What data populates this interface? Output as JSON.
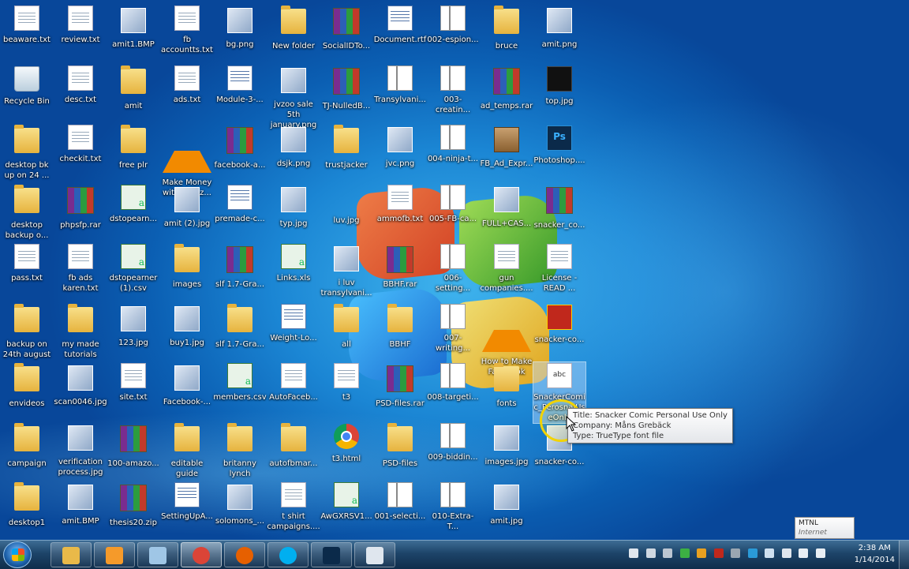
{
  "desktop": {
    "columns": [
      [
        {
          "label": "beaware.txt",
          "icon": "text-file-icon",
          "kind": "g-txt"
        },
        {
          "label": "Recycle Bin",
          "icon": "recycle-bin-icon",
          "kind": "g-recycle"
        },
        {
          "label": "desktop bk up on 24 ...",
          "icon": "folder-icon",
          "kind": "g-folder"
        },
        {
          "label": "desktop backup o...",
          "icon": "folder-icon",
          "kind": "g-folder"
        },
        {
          "label": "pass.txt",
          "icon": "text-file-icon",
          "kind": "g-txt"
        },
        {
          "label": "backup on 24th august",
          "icon": "folder-icon",
          "kind": "g-folder"
        },
        {
          "label": "envideos",
          "icon": "folder-icon",
          "kind": "g-folder"
        },
        {
          "label": "campaign",
          "icon": "folder-icon",
          "kind": "g-folder"
        },
        {
          "label": "desktop1",
          "icon": "folder-icon",
          "kind": "g-folder"
        }
      ],
      [
        {
          "label": "review.txt",
          "icon": "text-file-icon",
          "kind": "g-txt"
        },
        {
          "label": "desc.txt",
          "icon": "text-file-icon",
          "kind": "g-txt"
        },
        {
          "label": "checkit.txt",
          "icon": "text-file-icon",
          "kind": "g-txt"
        },
        {
          "label": "phpsfp.rar",
          "icon": "rar-archive-icon",
          "kind": "g-rar"
        },
        {
          "label": "fb ads karen.txt",
          "icon": "text-file-icon",
          "kind": "g-txt"
        },
        {
          "label": "my made tutorials",
          "icon": "folder-shortcut-icon",
          "kind": "g-folder"
        },
        {
          "label": "scan0046.jpg",
          "icon": "image-file-icon",
          "kind": "g-img"
        },
        {
          "label": "verification process.jpg",
          "icon": "image-file-icon",
          "kind": "g-img"
        },
        {
          "label": "amit.BMP",
          "icon": "image-file-icon",
          "kind": "g-img"
        }
      ],
      [
        {
          "label": "amit1.BMP",
          "icon": "image-file-icon",
          "kind": "g-img"
        },
        {
          "label": "amit",
          "icon": "folder-icon",
          "kind": "g-folder"
        },
        {
          "label": "free plr",
          "icon": "folder-icon",
          "kind": "g-folder"
        },
        {
          "label": "dstopearn...",
          "icon": "csv-file-icon",
          "kind": "g-xls"
        },
        {
          "label": "dstopearner (1).csv",
          "icon": "csv-file-icon",
          "kind": "g-xls"
        },
        {
          "label": "123.jpg",
          "icon": "image-file-icon",
          "kind": "g-img"
        },
        {
          "label": "site.txt",
          "icon": "text-file-icon",
          "kind": "g-txt"
        },
        {
          "label": "100-amazo...",
          "icon": "rar-archive-icon",
          "kind": "g-rar"
        },
        {
          "label": "thesis20.zip",
          "icon": "rar-archive-icon",
          "kind": "g-rar"
        }
      ],
      [
        {
          "label": "fb accountts.txt",
          "icon": "text-file-icon",
          "kind": "g-txt"
        },
        {
          "label": "ads.txt",
          "icon": "text-file-icon",
          "kind": "g-txt"
        },
        {
          "label": "Make Money with Amaz...",
          "icon": "vlc-media-icon",
          "kind": "g-vlc"
        },
        {
          "label": "amit (2).jpg",
          "icon": "image-file-icon",
          "kind": "g-img"
        },
        {
          "label": "images",
          "icon": "folder-icon",
          "kind": "g-folder"
        },
        {
          "label": "buy1.jpg",
          "icon": "image-file-icon",
          "kind": "g-img"
        },
        {
          "label": "Facebook-...",
          "icon": "image-file-icon",
          "kind": "g-img"
        },
        {
          "label": "editable guide",
          "icon": "folder-icon",
          "kind": "g-folder"
        },
        {
          "label": "SettingUpA...",
          "icon": "document-icon",
          "kind": "g-doc"
        }
      ],
      [
        {
          "label": "bg.png",
          "icon": "image-file-icon",
          "kind": "g-img"
        },
        {
          "label": "Module-3-...",
          "icon": "document-icon",
          "kind": "g-doc"
        },
        {
          "label": "facebook-a...",
          "icon": "rar-archive-icon",
          "kind": "g-rar"
        },
        {
          "label": "premade-c...",
          "icon": "document-icon",
          "kind": "g-doc"
        },
        {
          "label": "slf 1.7-Gra...",
          "icon": "rar-archive-icon",
          "kind": "g-rar"
        },
        {
          "label": "slf 1.7-Gra...",
          "icon": "folder-icon",
          "kind": "g-folder"
        },
        {
          "label": "members.csv",
          "icon": "csv-file-icon",
          "kind": "g-xls"
        },
        {
          "label": "britanny lynch",
          "icon": "folder-icon",
          "kind": "g-folder"
        },
        {
          "label": "solomons_...",
          "icon": "image-file-icon",
          "kind": "g-img"
        }
      ],
      [
        {
          "label": "New folder",
          "icon": "folder-icon",
          "kind": "g-folder"
        },
        {
          "label": "jvzoo sale 5th january.png",
          "icon": "image-file-icon",
          "kind": "g-img"
        },
        {
          "label": "dsjk.png",
          "icon": "image-file-icon",
          "kind": "g-img"
        },
        {
          "label": "typ.jpg",
          "icon": "image-file-icon",
          "kind": "g-img"
        },
        {
          "label": "Links.xls",
          "icon": "excel-file-icon",
          "kind": "g-xls"
        },
        {
          "label": "Weight-Lo...",
          "icon": "document-icon",
          "kind": "g-doc"
        },
        {
          "label": "AutoFaceb...",
          "icon": "text-file-icon",
          "kind": "g-txt"
        },
        {
          "label": "autofbmar...",
          "icon": "folder-icon",
          "kind": "g-folder"
        },
        {
          "label": "t shirt campaigns....",
          "icon": "text-file-icon",
          "kind": "g-txt"
        }
      ],
      [
        {
          "label": "SocialIDTo...",
          "icon": "rar-archive-icon",
          "kind": "g-rar"
        },
        {
          "label": "TJ-NulledB...",
          "icon": "rar-archive-icon",
          "kind": "g-rar"
        },
        {
          "label": "trustjacker",
          "icon": "folder-icon",
          "kind": "g-folder"
        },
        {
          "label": "luv.jpg",
          "icon": "heart-image-icon",
          "kind": "g-heart"
        },
        {
          "label": "i luv transylvani...",
          "icon": "image-file-icon",
          "kind": "g-img"
        },
        {
          "label": "all",
          "icon": "folder-icon",
          "kind": "g-folder"
        },
        {
          "label": "t3",
          "icon": "blank-file-icon",
          "kind": "g-txt"
        },
        {
          "label": "t3.html",
          "icon": "chrome-html-icon",
          "kind": "g-chrome"
        },
        {
          "label": "AwGXRSV1...",
          "icon": "excel-file-icon",
          "kind": "g-xls"
        }
      ],
      [
        {
          "label": "Document.rtf",
          "icon": "document-icon",
          "kind": "g-doc"
        },
        {
          "label": "Transylvani...",
          "icon": "zip-file-icon",
          "kind": "g-zip"
        },
        {
          "label": "jvc.png",
          "icon": "image-file-icon",
          "kind": "g-img"
        },
        {
          "label": "ammofb.txt",
          "icon": "text-file-icon",
          "kind": "g-txt"
        },
        {
          "label": "BBHF.rar",
          "icon": "rar-archive-icon",
          "kind": "g-rar"
        },
        {
          "label": "BBHF",
          "icon": "folder-icon",
          "kind": "g-folder"
        },
        {
          "label": "PSD-files.rar",
          "icon": "rar-archive-icon",
          "kind": "g-rar"
        },
        {
          "label": "PSD-files",
          "icon": "folder-icon",
          "kind": "g-folder"
        },
        {
          "label": "001-selecti...",
          "icon": "zip-file-icon",
          "kind": "g-zip"
        }
      ],
      [
        {
          "label": "002-espion...",
          "icon": "zip-file-icon",
          "kind": "g-zip"
        },
        {
          "label": "003-creatin...",
          "icon": "zip-file-icon",
          "kind": "g-zip"
        },
        {
          "label": "004-ninja-t...",
          "icon": "zip-file-icon",
          "kind": "g-zip"
        },
        {
          "label": "005-FB-ca...",
          "icon": "zip-file-icon",
          "kind": "g-zip"
        },
        {
          "label": "006-setting...",
          "icon": "zip-file-icon",
          "kind": "g-zip"
        },
        {
          "label": "007-writing...",
          "icon": "zip-file-icon",
          "kind": "g-zip"
        },
        {
          "label": "008-targeti...",
          "icon": "zip-file-icon",
          "kind": "g-zip"
        },
        {
          "label": "009-biddin...",
          "icon": "zip-file-icon",
          "kind": "g-zip"
        },
        {
          "label": "010-Extra-T...",
          "icon": "zip-file-icon",
          "kind": "g-zip"
        }
      ],
      [
        {
          "label": "bruce",
          "icon": "folder-icon",
          "kind": "g-folder"
        },
        {
          "label": "ad_temps.rar",
          "icon": "rar-archive-icon",
          "kind": "g-rar"
        },
        {
          "label": "FB_Ad_Expr...",
          "icon": "package-icon",
          "kind": "g-box"
        },
        {
          "label": "FULL+CAS...",
          "icon": "image-file-icon",
          "kind": "g-img"
        },
        {
          "label": "gun companies....",
          "icon": "text-file-icon",
          "kind": "g-txt"
        },
        {
          "label": "How to Make Facebook C...",
          "icon": "vlc-media-icon",
          "kind": "g-vlc"
        },
        {
          "label": "fonts",
          "icon": "folder-icon",
          "kind": "g-folder"
        },
        {
          "label": "images.jpg",
          "icon": "image-file-icon",
          "kind": "g-img"
        },
        {
          "label": "amit.jpg",
          "icon": "image-file-icon",
          "kind": "g-img"
        }
      ],
      [
        {
          "label": "amit.png",
          "icon": "image-file-icon",
          "kind": "g-img"
        },
        {
          "label": "top.jpg",
          "icon": "dark-image-icon",
          "kind": "g-dark"
        },
        {
          "label": "Photoshop....",
          "icon": "photoshop-icon",
          "kind": "g-ps",
          "glyph": "Ps"
        },
        {
          "label": "snacker_co...",
          "icon": "rar-archive-icon",
          "kind": "g-rar"
        },
        {
          "label": "License - READ ...",
          "icon": "text-file-icon",
          "kind": "g-txt"
        },
        {
          "label": "snacker-co...",
          "icon": "comic-image-icon",
          "kind": "g-comic"
        },
        {
          "label": "SnackerComic_PerosnalUseOnly",
          "icon": "font-file-icon",
          "kind": "g-font",
          "glyph": "abc",
          "selected": true
        },
        {
          "label": "snacker-co...",
          "icon": "image-file-icon",
          "kind": "g-img"
        }
      ]
    ]
  },
  "tooltip": {
    "title": "Title: Snacker Comic Personal Use Only",
    "company": "Company: Måns Grebäck",
    "type": "Type: TrueType font file"
  },
  "network_popup": {
    "name": "MTNL",
    "status": "Internet access"
  },
  "taskbar": {
    "pinned": [
      {
        "name": "explorer",
        "icon": "file-explorer-icon",
        "color": "#e9b949"
      },
      {
        "name": "media-player",
        "icon": "media-player-icon",
        "color": "#f59a2a"
      },
      {
        "name": "notes",
        "icon": "notes-icon",
        "color": "#9fc6e6"
      },
      {
        "name": "chrome",
        "icon": "chrome-icon",
        "color": "#db4437",
        "active": true
      },
      {
        "name": "firefox",
        "icon": "firefox-icon",
        "color": "#e66000"
      },
      {
        "name": "skype",
        "icon": "skype-icon",
        "color": "#00aff0"
      },
      {
        "name": "photoshop",
        "icon": "photoshop-icon",
        "color": "#0b2a4a"
      },
      {
        "name": "snipping-tool",
        "icon": "snipping-tool-icon",
        "color": "#dfe6ee"
      }
    ],
    "tray_icons": [
      "show-hidden-icon",
      "app-tray-icon",
      "app-tray-icon",
      "green-tray-icon",
      "chrome-tray-icon",
      "acrobat-tray-icon",
      "app-tray-icon",
      "sync-tray-icon",
      "bluetooth-icon",
      "network-icon",
      "volume-icon",
      "flag-icon"
    ],
    "time": "2:38 AM",
    "date": "1/14/2014"
  }
}
